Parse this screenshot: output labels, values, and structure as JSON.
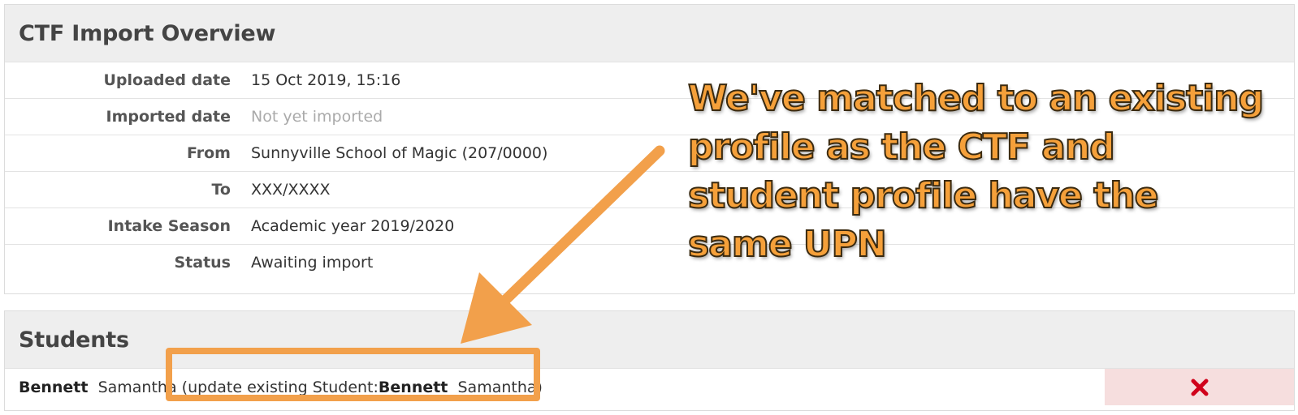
{
  "overview": {
    "title": "CTF Import Overview",
    "rows": [
      {
        "label": "Uploaded date",
        "value": "15 Oct 2019, 15:16"
      },
      {
        "label": "Imported date",
        "value": "Not yet imported"
      },
      {
        "label": "From",
        "value": "Sunnyville School of Magic (207/0000)"
      },
      {
        "label": "To",
        "value": "XXX/XXXX"
      },
      {
        "label": "Intake Season",
        "value": "Academic year 2019/2020"
      },
      {
        "label": "Status",
        "value": "Awaiting import"
      }
    ]
  },
  "students": {
    "title": "Students",
    "items": [
      {
        "surname": "Bennett",
        "forename": "Samantha",
        "note_prefix": "(update existing Student: ",
        "match_surname": "Bennett",
        "match_forename": "Samantha)",
        "remove_icon": "close-icon"
      }
    ]
  },
  "annotation": {
    "text": "We've matched to an existing profile as the CTF and student profile have the same UPN",
    "color": "#f5a03a"
  },
  "colors": {
    "remove_bg": "#f6dede",
    "remove_icon": "#d0021b",
    "highlight": "#f2a04b"
  }
}
